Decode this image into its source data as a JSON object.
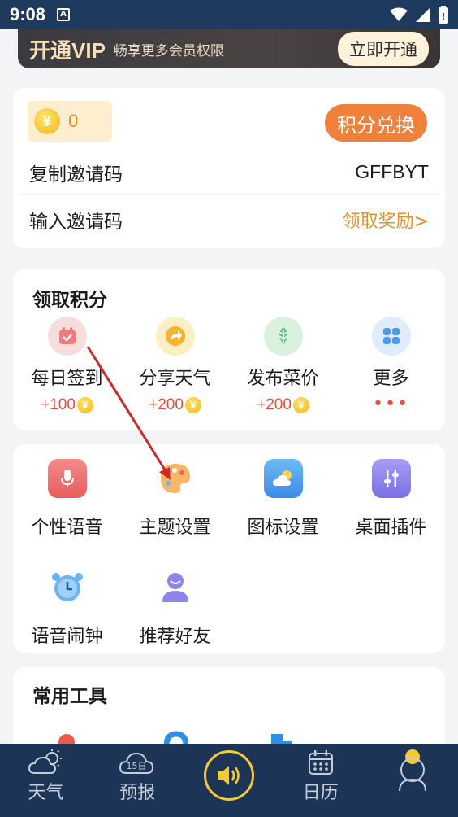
{
  "status_bar": {
    "time": "9:08",
    "a_badge": "A"
  },
  "vip": {
    "title": "开通VIP",
    "subtitle": "畅享更多会员权限",
    "button": "立即开通"
  },
  "points": {
    "coin_symbol": "¥",
    "count": "0",
    "exchange_button": "积分兑换",
    "copy_label": "复制邀请码",
    "invite_code": "GFFBYT",
    "enter_label": "输入邀请码",
    "reward_link": "领取奖励>"
  },
  "earn": {
    "title": "领取积分",
    "tasks": [
      {
        "label": "每日签到",
        "reward": "+100",
        "icon": "calendar-check-icon",
        "color": "#f2dada"
      },
      {
        "label": "分享天气",
        "reward": "+200",
        "icon": "share-arrow-icon",
        "color": "#fbeec2"
      },
      {
        "label": "发布菜价",
        "reward": "+200",
        "icon": "vegetable-icon",
        "color": "#d6f1dd"
      },
      {
        "label": "更多",
        "reward": "•••",
        "icon": "grid-more-icon",
        "color": "#dbe9fb"
      }
    ]
  },
  "tools": [
    {
      "label": "个性语音",
      "icon": "microphone-icon",
      "color": "#ef6a6a"
    },
    {
      "label": "主题设置",
      "icon": "palette-icon",
      "color": "#f5b26b"
    },
    {
      "label": "图标设置",
      "icon": "weather-icon",
      "color": "#4fa4ee"
    },
    {
      "label": "桌面插件",
      "icon": "sliders-icon",
      "color": "#8f84ee"
    },
    {
      "label": "语音闹钟",
      "icon": "alarm-clock-icon",
      "color": "#6cb3f2"
    },
    {
      "label": "推荐好友",
      "icon": "friend-icon",
      "color": "#8c86ea"
    }
  ],
  "common_tools": {
    "title": "常用工具"
  },
  "nav": {
    "weather": "天气",
    "forecast": "预报",
    "forecast_badge": "15日",
    "calendar": "日历"
  },
  "colors": {
    "accent_orange": "#f0803a",
    "nav_bg": "#1c3456",
    "reward_red": "#e84d3d",
    "arrow_red": "#cc2a2a"
  }
}
